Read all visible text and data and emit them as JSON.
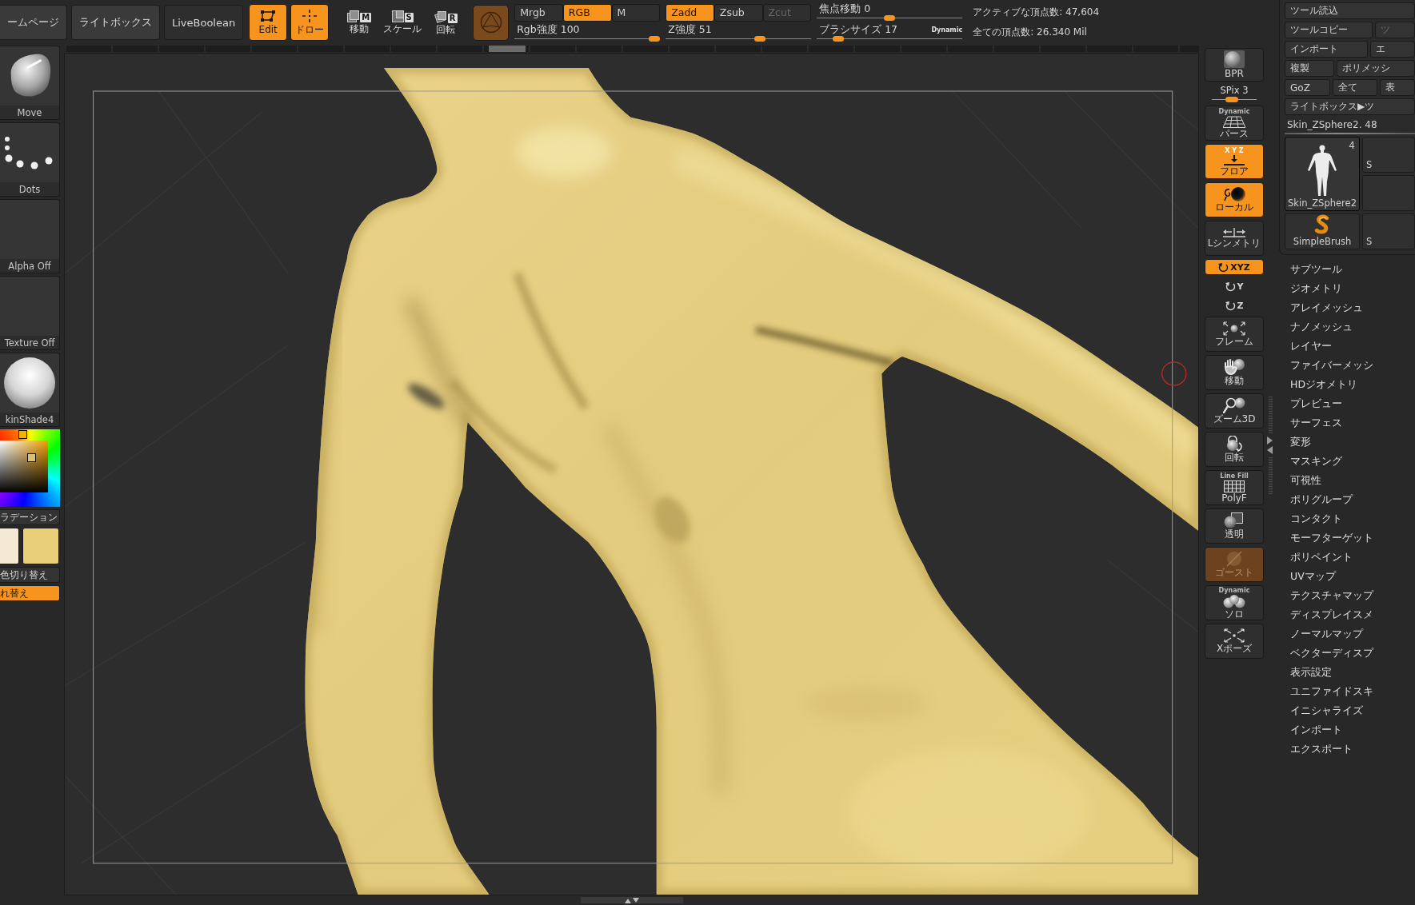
{
  "top_bar": {
    "nav_buttons": [
      {
        "kind": "link",
        "label": "ームページ"
      },
      {
        "kind": "link",
        "label": "ライトボックス"
      },
      {
        "kind": "toggle",
        "label": "LiveBoolean"
      }
    ],
    "modes": [
      {
        "kind": "edit",
        "label": "Edit",
        "selected": true
      },
      {
        "kind": "draw",
        "label": "ドロー",
        "selected": true
      }
    ],
    "transforms": [
      {
        "kind": "move",
        "key": "M",
        "label": "移動",
        "selected": false
      },
      {
        "kind": "scale",
        "key": "S",
        "label": "スケール",
        "selected": false
      },
      {
        "kind": "rotate",
        "key": "R",
        "label": "回転",
        "selected": false
      }
    ],
    "color_modes": [
      {
        "label": "Mrgb",
        "selected": false
      },
      {
        "label": "RGB",
        "selected": true
      },
      {
        "label": "M",
        "selected": false
      }
    ],
    "z_modes": [
      {
        "label": "Zadd",
        "selected": true,
        "disabled": false
      },
      {
        "label": "Zsub",
        "selected": false,
        "disabled": false
      },
      {
        "label": "Zcut",
        "selected": false,
        "disabled": true
      }
    ],
    "sliders": [
      {
        "label": "Rgb強度 100",
        "level": 1.0
      },
      {
        "label": "Z強度 51",
        "level": 0.66
      },
      {
        "label": "焦点移動 0",
        "level": 0.5
      },
      {
        "label": "ブラシサイズ 17",
        "level": 0.12,
        "badge": "Dynamic"
      }
    ],
    "stats": [
      "アクティブな頂点数: 47,604",
      "全ての頂点数: 26.340 Mil"
    ]
  },
  "left_shelf": {
    "thumbnails": [
      {
        "kind": "brush",
        "label": "Move"
      },
      {
        "kind": "stroke",
        "label": "Dots"
      },
      {
        "kind": "alpha",
        "label": "Alpha Off"
      },
      {
        "kind": "texture",
        "label": "Texture Off"
      },
      {
        "kind": "material",
        "label": "kinShade4"
      }
    ],
    "gradient": {
      "label": "ラデーション",
      "on": false
    },
    "swatches": [
      {
        "color": "#f4ead3"
      },
      {
        "color": "#e8cf78"
      }
    ],
    "buttons": [
      {
        "label": "色切り替え",
        "on": false
      },
      {
        "label": "れ替え",
        "on": true
      }
    ]
  },
  "view_shelf": {
    "render_button": {
      "label": "BPR"
    },
    "spix": {
      "label": "SPix 3",
      "level": 0.43
    },
    "buttons": [
      {
        "kind": "perspective",
        "caption": "Dynamic",
        "label": "パース",
        "on": false,
        "disabled": false
      },
      {
        "kind": "floor",
        "caption": "X Y Z",
        "label": "フロア",
        "on": true,
        "disabled": false
      },
      {
        "kind": "local",
        "label": "ローカル",
        "on": true,
        "disabled": false
      },
      {
        "kind": "symmetry",
        "label": "Lシンメトリ",
        "on": false,
        "disabled": false
      },
      {
        "kind": "axis",
        "label": "XYZ",
        "on": true,
        "disabled": false
      },
      {
        "kind": "axis",
        "label": "Y",
        "on": false,
        "disabled": false
      },
      {
        "kind": "axis",
        "label": "Z",
        "on": false,
        "disabled": false
      },
      {
        "kind": "frame",
        "label": "フレーム",
        "on": false,
        "disabled": false
      },
      {
        "kind": "move",
        "label": "移動",
        "on": false,
        "disabled": false
      },
      {
        "kind": "zoom",
        "label": "ズーム3D",
        "on": false,
        "disabled": false
      },
      {
        "kind": "rotate",
        "label": "回転",
        "on": false,
        "disabled": false
      },
      {
        "kind": "polyframe",
        "caption": "Line Fill",
        "label": "PolyF",
        "on": false,
        "disabled": false
      },
      {
        "kind": "transparent",
        "label": "透明",
        "on": false,
        "disabled": false
      },
      {
        "kind": "ghost",
        "label": "ゴースト",
        "on": true,
        "disabled": true
      },
      {
        "kind": "solo",
        "caption": "Dynamic",
        "label": "ソロ",
        "on": false,
        "disabled": false
      },
      {
        "kind": "xpose",
        "label": "Xポーズ",
        "on": false,
        "disabled": false
      }
    ]
  },
  "tool_panel": {
    "rows": [
      {
        "buttons": [
          {
            "label": "ツール読込",
            "disabled": false
          }
        ]
      },
      {
        "buttons": [
          {
            "label": "ツールコピー",
            "disabled": false
          },
          {
            "label": "ツ",
            "disabled": true
          }
        ]
      },
      {
        "buttons": [
          {
            "label": "インポート",
            "disabled": false
          },
          {
            "label": "エ",
            "disabled": false
          }
        ]
      },
      {
        "buttons": [
          {
            "label": "複製",
            "disabled": false
          },
          {
            "label": "ポリメッシ",
            "disabled": false
          }
        ]
      },
      {
        "buttons": [
          {
            "label": "GoZ",
            "disabled": false
          },
          {
            "label": "全て",
            "disabled": false
          },
          {
            "label": "表",
            "disabled": false
          }
        ]
      },
      {
        "buttons": [
          {
            "label": "ライトボックス▶ツ",
            "disabled": false
          }
        ]
      }
    ],
    "current_tool": "Skin_ZSphere2. 48",
    "tools": [
      {
        "kind": "figure",
        "label": "Skin_ZSphere2",
        "count": "4",
        "selected": true
      },
      {
        "kind": "partial",
        "label": "S",
        "selected": false
      },
      {
        "kind": "blank",
        "selected": false
      },
      {
        "kind": "brush",
        "label": "SimpleBrush",
        "selected": false
      },
      {
        "kind": "partial",
        "label": "S",
        "selected": false
      }
    ],
    "menu": [
      "サブツール",
      "ジオメトリ",
      "アレイメッシュ",
      "ナノメッシュ",
      "レイヤー",
      "ファイバーメッシ",
      "HDジオメトリ",
      "プレビュー",
      "サーフェス",
      "変形",
      "マスキング",
      "可視性",
      "ポリグループ",
      "コンタクト",
      "モーフターゲット",
      "ポリペイント",
      "UVマップ",
      "テクスチャマップ",
      "ディスプレイスメ",
      "ノーマルマップ",
      "ベクターディスプ",
      "表示設定",
      "ユニファイドスキ",
      "イニシャライズ",
      "インポート",
      "エクスポート"
    ]
  }
}
